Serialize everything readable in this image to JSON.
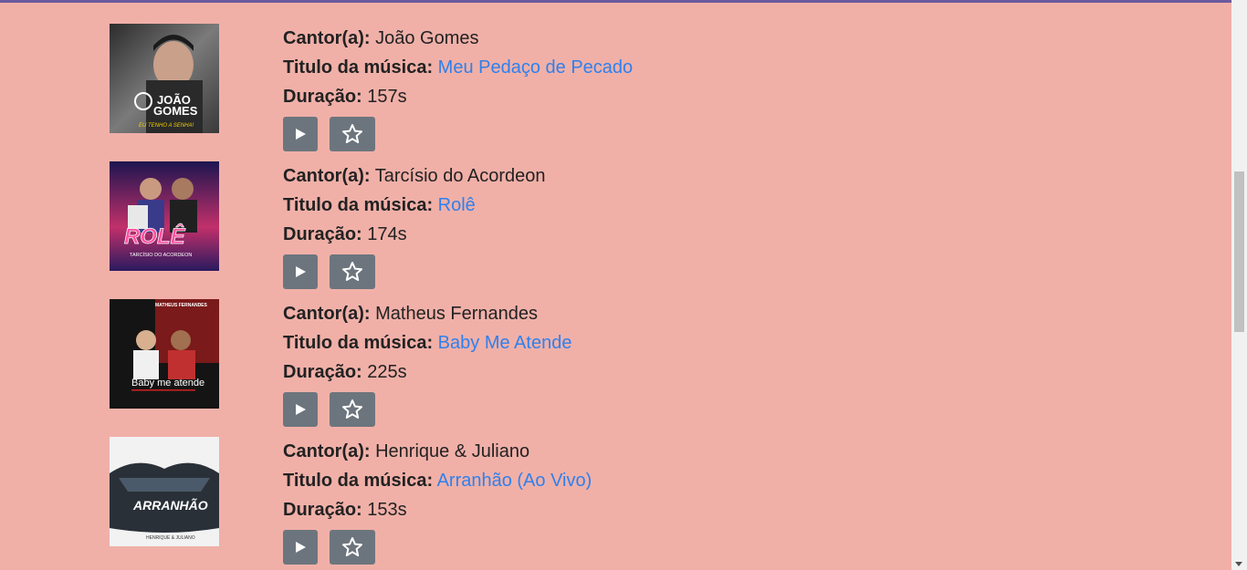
{
  "labels": {
    "artist": "Cantor(a):",
    "title": "Titulo da música:",
    "duration": "Duração:"
  },
  "songs": [
    {
      "artist": "João Gomes",
      "title": "Meu Pedaço de Pecado",
      "duration": "157s",
      "cover_text": [
        "JOÃO",
        "GOMES",
        "EU TENHO A SENHA!"
      ],
      "cover_colors": [
        "#3a3a3a",
        "#8a8a8a"
      ]
    },
    {
      "artist": "Tarcísio do Acordeon",
      "title": "Rolê",
      "duration": "174s",
      "cover_text": [
        "ROLÊ",
        "TARCÍSIO DO ACORDEON"
      ],
      "cover_colors": [
        "#2a1a5e",
        "#e0407a"
      ]
    },
    {
      "artist": "Matheus Fernandes",
      "title": "Baby Me Atende",
      "duration": "225s",
      "cover_text": [
        "Baby me atende",
        "MATHEUS FERNANDES"
      ],
      "cover_colors": [
        "#1a1a1a",
        "#b02020"
      ]
    },
    {
      "artist": "Henrique & Juliano",
      "title": "Arranhão (Ao Vivo)",
      "duration": "153s",
      "cover_text": [
        "ARRANHÃO",
        "HENRIQUE & JULIANO"
      ],
      "cover_colors": [
        "#f4f4f4",
        "#2a2a2a"
      ]
    }
  ],
  "icons": {
    "play": "play-icon",
    "favorite": "star-icon"
  },
  "colors": {
    "background": "#f0b0a8",
    "link": "#2f80ed",
    "button": "#6c757d"
  }
}
